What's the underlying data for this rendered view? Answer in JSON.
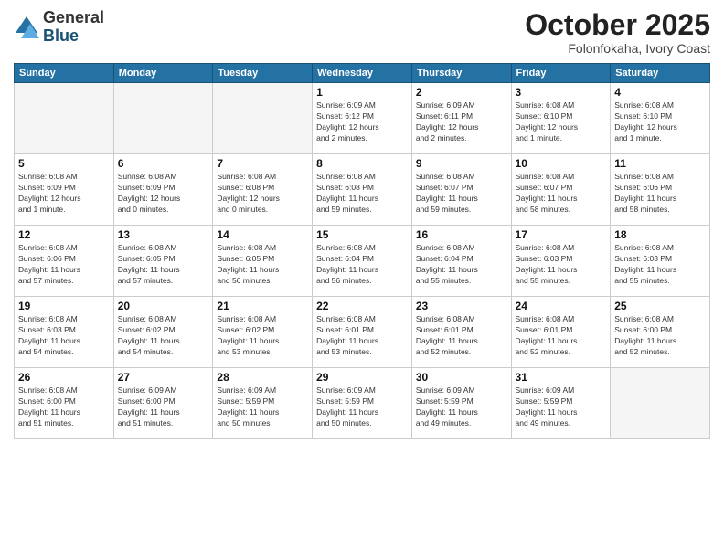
{
  "logo": {
    "general": "General",
    "blue": "Blue"
  },
  "header": {
    "month": "October 2025",
    "location": "Folonfokaha, Ivory Coast"
  },
  "weekdays": [
    "Sunday",
    "Monday",
    "Tuesday",
    "Wednesday",
    "Thursday",
    "Friday",
    "Saturday"
  ],
  "weeks": [
    [
      {
        "day": "",
        "info": ""
      },
      {
        "day": "",
        "info": ""
      },
      {
        "day": "",
        "info": ""
      },
      {
        "day": "1",
        "info": "Sunrise: 6:09 AM\nSunset: 6:12 PM\nDaylight: 12 hours\nand 2 minutes."
      },
      {
        "day": "2",
        "info": "Sunrise: 6:09 AM\nSunset: 6:11 PM\nDaylight: 12 hours\nand 2 minutes."
      },
      {
        "day": "3",
        "info": "Sunrise: 6:08 AM\nSunset: 6:10 PM\nDaylight: 12 hours\nand 1 minute."
      },
      {
        "day": "4",
        "info": "Sunrise: 6:08 AM\nSunset: 6:10 PM\nDaylight: 12 hours\nand 1 minute."
      }
    ],
    [
      {
        "day": "5",
        "info": "Sunrise: 6:08 AM\nSunset: 6:09 PM\nDaylight: 12 hours\nand 1 minute."
      },
      {
        "day": "6",
        "info": "Sunrise: 6:08 AM\nSunset: 6:09 PM\nDaylight: 12 hours\nand 0 minutes."
      },
      {
        "day": "7",
        "info": "Sunrise: 6:08 AM\nSunset: 6:08 PM\nDaylight: 12 hours\nand 0 minutes."
      },
      {
        "day": "8",
        "info": "Sunrise: 6:08 AM\nSunset: 6:08 PM\nDaylight: 11 hours\nand 59 minutes."
      },
      {
        "day": "9",
        "info": "Sunrise: 6:08 AM\nSunset: 6:07 PM\nDaylight: 11 hours\nand 59 minutes."
      },
      {
        "day": "10",
        "info": "Sunrise: 6:08 AM\nSunset: 6:07 PM\nDaylight: 11 hours\nand 58 minutes."
      },
      {
        "day": "11",
        "info": "Sunrise: 6:08 AM\nSunset: 6:06 PM\nDaylight: 11 hours\nand 58 minutes."
      }
    ],
    [
      {
        "day": "12",
        "info": "Sunrise: 6:08 AM\nSunset: 6:06 PM\nDaylight: 11 hours\nand 57 minutes."
      },
      {
        "day": "13",
        "info": "Sunrise: 6:08 AM\nSunset: 6:05 PM\nDaylight: 11 hours\nand 57 minutes."
      },
      {
        "day": "14",
        "info": "Sunrise: 6:08 AM\nSunset: 6:05 PM\nDaylight: 11 hours\nand 56 minutes."
      },
      {
        "day": "15",
        "info": "Sunrise: 6:08 AM\nSunset: 6:04 PM\nDaylight: 11 hours\nand 56 minutes."
      },
      {
        "day": "16",
        "info": "Sunrise: 6:08 AM\nSunset: 6:04 PM\nDaylight: 11 hours\nand 55 minutes."
      },
      {
        "day": "17",
        "info": "Sunrise: 6:08 AM\nSunset: 6:03 PM\nDaylight: 11 hours\nand 55 minutes."
      },
      {
        "day": "18",
        "info": "Sunrise: 6:08 AM\nSunset: 6:03 PM\nDaylight: 11 hours\nand 55 minutes."
      }
    ],
    [
      {
        "day": "19",
        "info": "Sunrise: 6:08 AM\nSunset: 6:03 PM\nDaylight: 11 hours\nand 54 minutes."
      },
      {
        "day": "20",
        "info": "Sunrise: 6:08 AM\nSunset: 6:02 PM\nDaylight: 11 hours\nand 54 minutes."
      },
      {
        "day": "21",
        "info": "Sunrise: 6:08 AM\nSunset: 6:02 PM\nDaylight: 11 hours\nand 53 minutes."
      },
      {
        "day": "22",
        "info": "Sunrise: 6:08 AM\nSunset: 6:01 PM\nDaylight: 11 hours\nand 53 minutes."
      },
      {
        "day": "23",
        "info": "Sunrise: 6:08 AM\nSunset: 6:01 PM\nDaylight: 11 hours\nand 52 minutes."
      },
      {
        "day": "24",
        "info": "Sunrise: 6:08 AM\nSunset: 6:01 PM\nDaylight: 11 hours\nand 52 minutes."
      },
      {
        "day": "25",
        "info": "Sunrise: 6:08 AM\nSunset: 6:00 PM\nDaylight: 11 hours\nand 52 minutes."
      }
    ],
    [
      {
        "day": "26",
        "info": "Sunrise: 6:08 AM\nSunset: 6:00 PM\nDaylight: 11 hours\nand 51 minutes."
      },
      {
        "day": "27",
        "info": "Sunrise: 6:09 AM\nSunset: 6:00 PM\nDaylight: 11 hours\nand 51 minutes."
      },
      {
        "day": "28",
        "info": "Sunrise: 6:09 AM\nSunset: 5:59 PM\nDaylight: 11 hours\nand 50 minutes."
      },
      {
        "day": "29",
        "info": "Sunrise: 6:09 AM\nSunset: 5:59 PM\nDaylight: 11 hours\nand 50 minutes."
      },
      {
        "day": "30",
        "info": "Sunrise: 6:09 AM\nSunset: 5:59 PM\nDaylight: 11 hours\nand 49 minutes."
      },
      {
        "day": "31",
        "info": "Sunrise: 6:09 AM\nSunset: 5:59 PM\nDaylight: 11 hours\nand 49 minutes."
      },
      {
        "day": "",
        "info": ""
      }
    ]
  ]
}
